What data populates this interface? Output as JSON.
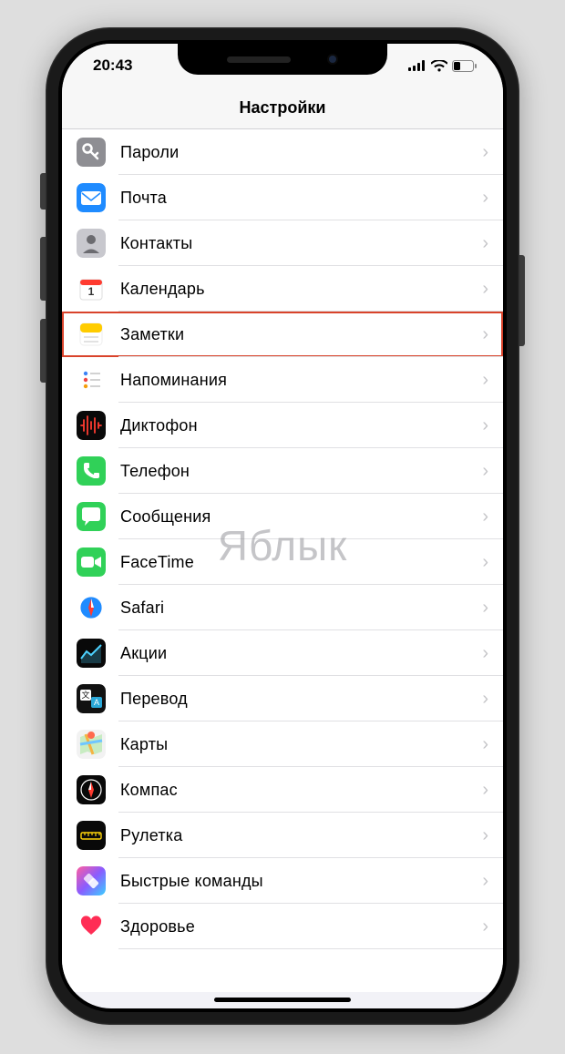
{
  "status": {
    "time": "20:43",
    "signal": 4,
    "wifi": true,
    "battery": 30
  },
  "nav": {
    "title": "Настройки"
  },
  "watermark": "Яблык",
  "rows": [
    {
      "id": "passwords",
      "label": "Пароли",
      "icon": "key",
      "bg": "#8e8e93",
      "fg": "#ffffff",
      "hl": false
    },
    {
      "id": "mail",
      "label": "Почта",
      "icon": "mail",
      "bg": "#1f8bff",
      "fg": "#ffffff",
      "hl": false
    },
    {
      "id": "contacts",
      "label": "Контакты",
      "icon": "contacts",
      "bg": "#c8c8ce",
      "fg": "#6b6b70",
      "hl": false
    },
    {
      "id": "calendar",
      "label": "Календарь",
      "icon": "calendar",
      "bg": "#ffffff",
      "fg": "#ff3b30",
      "hl": false
    },
    {
      "id": "notes",
      "label": "Заметки",
      "icon": "notes",
      "bg": "#ffffff",
      "fg": "#ffcc00",
      "hl": true
    },
    {
      "id": "reminders",
      "label": "Напоминания",
      "icon": "reminders",
      "bg": "#ffffff",
      "fg": "#000000",
      "hl": false
    },
    {
      "id": "voicememos",
      "label": "Диктофон",
      "icon": "waveform",
      "bg": "#090909",
      "fg": "#ff3b30",
      "hl": false
    },
    {
      "id": "phone",
      "label": "Телефон",
      "icon": "phone",
      "bg": "#30d158",
      "fg": "#ffffff",
      "hl": false
    },
    {
      "id": "messages",
      "label": "Сообщения",
      "icon": "bubble",
      "bg": "#30d158",
      "fg": "#ffffff",
      "hl": false
    },
    {
      "id": "facetime",
      "label": "FaceTime",
      "icon": "video",
      "bg": "#30d158",
      "fg": "#ffffff",
      "hl": false
    },
    {
      "id": "safari",
      "label": "Safari",
      "icon": "compass",
      "bg": "#ffffff",
      "fg": "#1f8bff",
      "hl": false
    },
    {
      "id": "stocks",
      "label": "Акции",
      "icon": "stocks",
      "bg": "#090909",
      "fg": "#ffffff",
      "hl": false
    },
    {
      "id": "translate",
      "label": "Перевод",
      "icon": "translate",
      "bg": "#111111",
      "fg": "#ffffff",
      "hl": false
    },
    {
      "id": "maps",
      "label": "Карты",
      "icon": "maps",
      "bg": "#f2f2f2",
      "fg": "#34c759",
      "hl": false
    },
    {
      "id": "compass",
      "label": "Компас",
      "icon": "compass2",
      "bg": "#090909",
      "fg": "#ffffff",
      "hl": false
    },
    {
      "id": "measure",
      "label": "Рулетка",
      "icon": "ruler",
      "bg": "#090909",
      "fg": "#ffffff",
      "hl": false
    },
    {
      "id": "shortcuts",
      "label": "Быстрые команды",
      "icon": "shortcuts",
      "bg": "#2b2f5c",
      "fg": "#ffffff",
      "hl": false
    },
    {
      "id": "health",
      "label": "Здоровье",
      "icon": "heart",
      "bg": "#ffffff",
      "fg": "#ff2d55",
      "hl": false
    }
  ]
}
